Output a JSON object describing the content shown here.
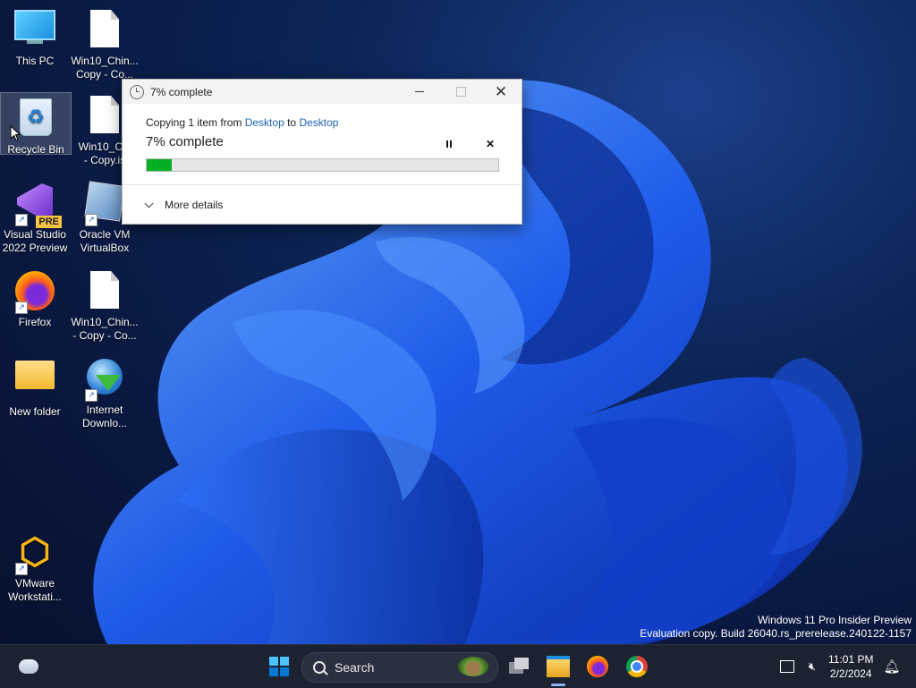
{
  "desktop_icons": [
    {
      "label_1": "This PC",
      "label_2": "",
      "icon": "monitor-icon"
    },
    {
      "label_1": "Recycle Bin",
      "label_2": "",
      "icon": "recycle-bin-icon"
    },
    {
      "label_1": "Visual Studio",
      "label_2": "2022 Preview",
      "icon": "visual-studio-icon",
      "badge": "PRE"
    },
    {
      "label_1": "Firefox",
      "label_2": "",
      "icon": "firefox-icon"
    },
    {
      "label_1": "New folder",
      "label_2": "",
      "icon": "folder-icon"
    },
    {
      "label_1": "VMware",
      "label_2": "Workstati...",
      "icon": "vmware-icon"
    },
    {
      "label_1": "Win10_Chin...",
      "label_2": "Copy - Co...",
      "icon": "file-icon"
    },
    {
      "label_1": "Win10_Chi",
      "label_2": "- Copy.is",
      "icon": "file-icon"
    },
    {
      "label_1": "Oracle VM",
      "label_2": "VirtualBox",
      "icon": "virtualbox-icon"
    },
    {
      "label_1": "Win10_Chin...",
      "label_2": "- Copy - Co...",
      "icon": "file-icon"
    },
    {
      "label_1": "Internet",
      "label_2": "Downlo...",
      "icon": "internet-download-manager-icon"
    }
  ],
  "dialog": {
    "title": "7% complete",
    "copy_prefix": "Copying 1 item from ",
    "source": "Desktop",
    "copy_mid": " to ",
    "destination": "Desktop",
    "status": "7% complete",
    "progress": 0.07,
    "more_details": "More details",
    "progress_color": "#06b025"
  },
  "watermark": {
    "line1": "Windows 11 Pro Insider Preview",
    "line2": "Evaluation copy. Build 26040.rs_prerelease.240122-1157"
  },
  "taskbar": {
    "search_placeholder": "Search",
    "time": "11:01 PM",
    "date": "2/2/2024",
    "items": [
      "weather-icon",
      "start-icon",
      "task-view-icon",
      "file-explorer-icon",
      "firefox-icon",
      "chrome-icon"
    ]
  }
}
